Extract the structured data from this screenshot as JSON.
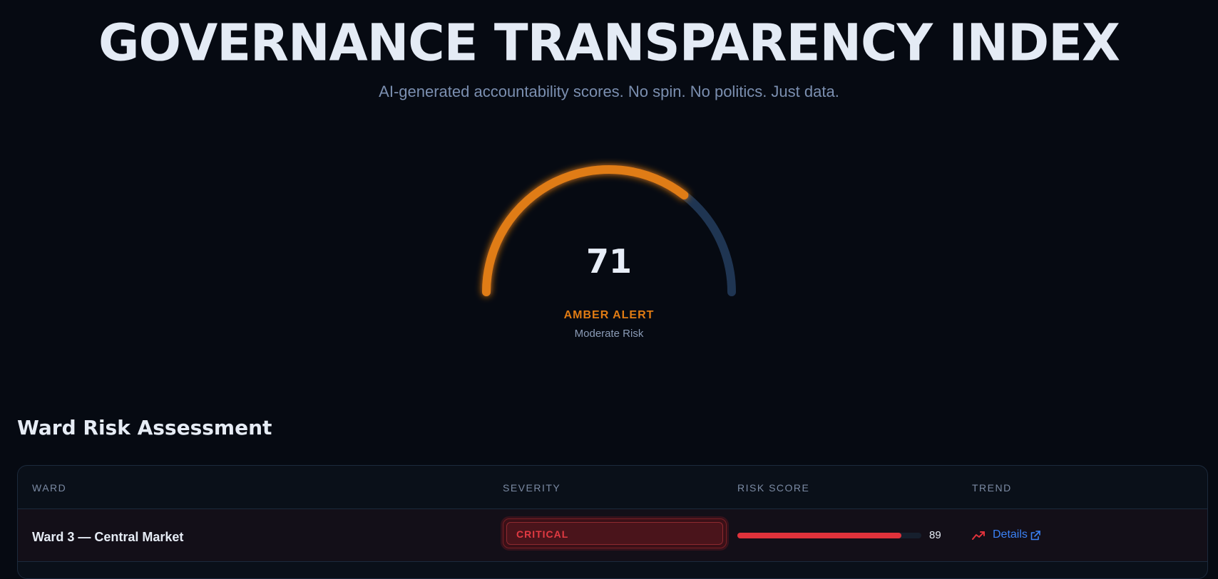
{
  "header": {
    "title": "GOVERNANCE TRANSPARENCY INDEX",
    "subtitle": "AI-generated accountability scores. No spin. No politics. Just data."
  },
  "gauge": {
    "value": "71",
    "fraction": 0.71,
    "status": "AMBER ALERT",
    "risk_label": "Moderate Risk",
    "active_color": "#e07b13",
    "track_color": "#1f3552"
  },
  "ward_section": {
    "title": "Ward Risk Assessment",
    "columns": [
      "WARD",
      "SEVERITY",
      "RISK SCORE",
      "TREND"
    ],
    "rows": [
      {
        "ward": "Ward 3 — Central Market",
        "severity": "CRITICAL",
        "risk_score": "89",
        "risk_fraction": 0.89,
        "trend_icon": "trending-up-icon",
        "details_label": "Details",
        "details_icon": "external-link-icon"
      }
    ]
  },
  "colors": {
    "background": "#060a12",
    "critical": "#e0323b",
    "link": "#3b82f6",
    "amber": "#e07b13"
  }
}
